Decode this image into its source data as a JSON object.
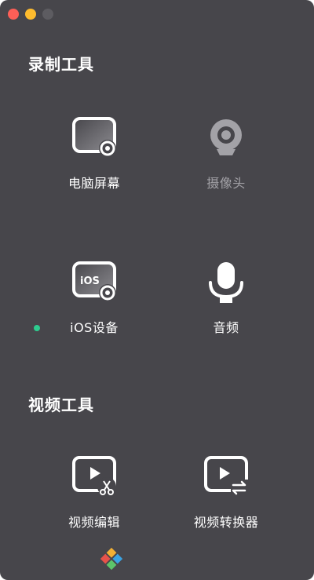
{
  "window": {
    "buttons": [
      "close",
      "minimize",
      "zoom"
    ]
  },
  "recording": {
    "section_title": "录制工具",
    "tools": [
      {
        "label": "电脑屏幕",
        "icon": "screen-record-icon",
        "enabled": true
      },
      {
        "label": "摄像头",
        "icon": "webcam-icon",
        "enabled": false
      },
      {
        "label": "iOS设备",
        "icon": "ios-device-icon",
        "enabled": true,
        "status": "connected"
      },
      {
        "label": "音频",
        "icon": "microphone-icon",
        "enabled": true
      }
    ]
  },
  "video": {
    "section_title": "视频工具",
    "tools": [
      {
        "label": "视频编辑",
        "icon": "video-edit-icon"
      },
      {
        "label": "视频转换器",
        "icon": "video-convert-icon"
      }
    ]
  },
  "colors": {
    "background": "#47464b",
    "status_green": "#2ecc8f",
    "disabled_text": "#a3a2a7"
  },
  "footer": {
    "logo_icon": "app-logo-icon"
  }
}
